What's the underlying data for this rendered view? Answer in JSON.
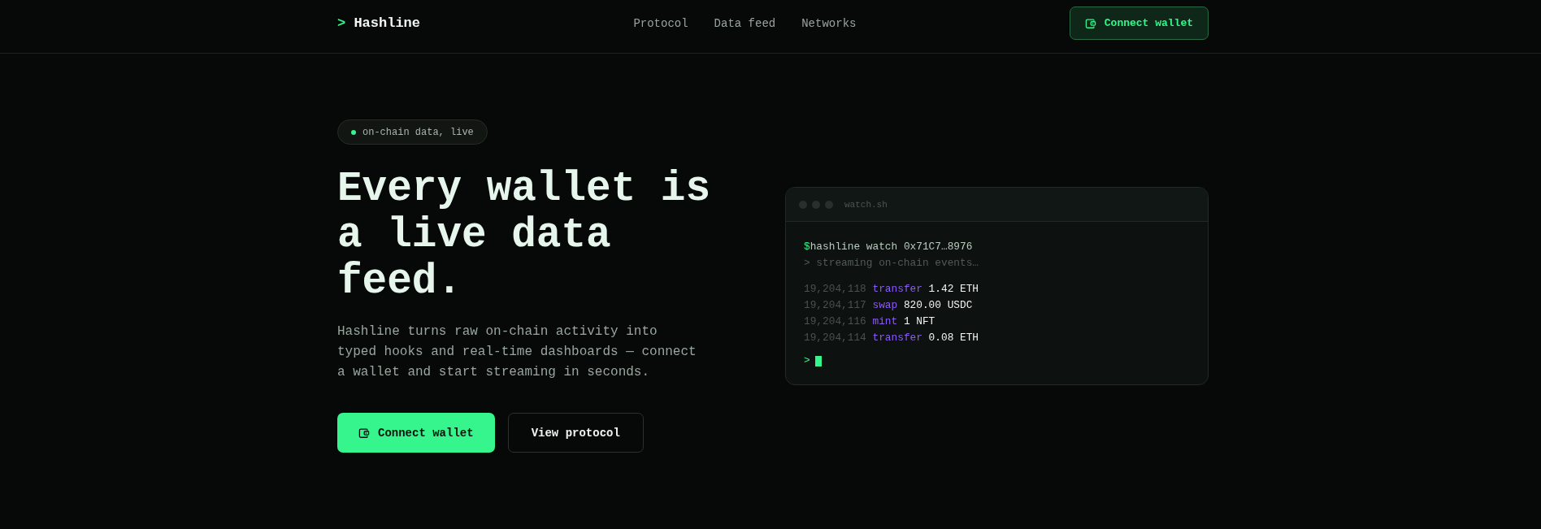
{
  "nav": {
    "logo": {
      "prompt": ">",
      "name": "Hashline"
    },
    "links": [
      "Protocol",
      "Data feed",
      "Networks"
    ],
    "cta": "Connect wallet"
  },
  "hero": {
    "badge": "on-chain data, live",
    "headline": "Every wallet is a live data feed.",
    "description": "Hashline turns raw on-chain activity into typed hooks and real-time dashboards — connect a wallet and start streaming in seconds.",
    "buttons": [
      {
        "label": "Connect wallet",
        "kind": "primary"
      },
      {
        "label": "View protocol",
        "kind": "secondary"
      }
    ]
  },
  "terminal": {
    "title": "watch.sh",
    "command_prompt": "$",
    "command": "hashline watch 0x71C7…8976",
    "status": "> streaming on-chain events…",
    "events": [
      {
        "block": "19,204,118",
        "action": "transfer",
        "amount": "1.42 ETH"
      },
      {
        "block": "19,204,117",
        "action": "swap",
        "amount": "820.00 USDC"
      },
      {
        "block": "19,204,116",
        "action": "mint",
        "amount": "1 NFT"
      },
      {
        "block": "19,204,114",
        "action": "transfer",
        "amount": "0.08 ETH"
      }
    ],
    "prompt": ">"
  }
}
